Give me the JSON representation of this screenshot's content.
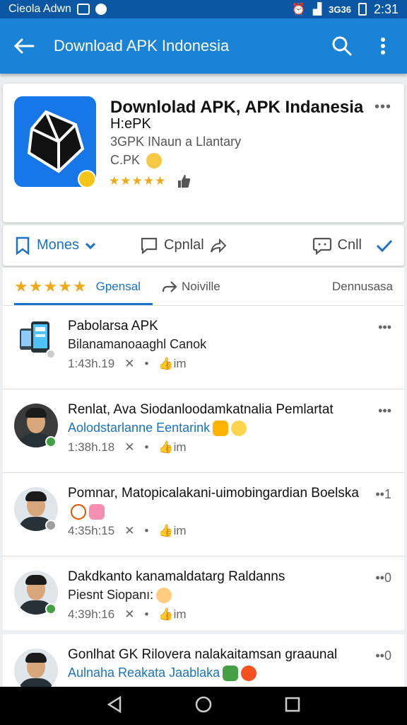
{
  "status_bar": {
    "carrier": "Cieola Adwn",
    "network": "3G36",
    "time": "2:31"
  },
  "app_bar": {
    "title": "Download APK Indonesia"
  },
  "app_card": {
    "title": "Downlolad APK, APK Indanesia",
    "subtitle": "H:ePK",
    "developer": "3GPK INaun a Llantary",
    "category": "C.PK",
    "rating_stars": "★★★★★",
    "more": "•••"
  },
  "actions": {
    "primary": "Mones",
    "middle": "Cpnlal",
    "right": "Cnll"
  },
  "tabs": {
    "stars": "★★★★★",
    "active": "Gpensal",
    "second": "Noiville",
    "third": "Dennusasa"
  },
  "feed": [
    {
      "title": "Pabolarsa APK",
      "subtitle": "Bilanamanoaaghl Canok",
      "time": "1:43h.19",
      "likes": "im",
      "more": "•••"
    },
    {
      "title": "Renlat, Ava Siodanloodamkatnalia Pemlartat",
      "subtitle": "Aolodstarlanne Eentarink",
      "time": "1:38h.18",
      "likes": "im",
      "more": "•••"
    },
    {
      "title": "Pomnar, Matopicalakani-uimobingardian Boelska",
      "subtitle": "",
      "time": "4:35h:15",
      "likes": "im",
      "more": "••1"
    },
    {
      "title": "Dakdkanto kanamaldatarg Raldanns",
      "subtitle": "Piesnt Siopanı:",
      "time": "4:39h:16",
      "likes": "im",
      "more": "••0"
    },
    {
      "title": "Gonlhat GK Rilovera nalakaitamsan graaunal",
      "subtitle": "Aulnaha Reakata Jaablaka",
      "more": "••0"
    }
  ],
  "colors": {
    "appbar": "#1a83d6",
    "statusbar": "#0b57a4",
    "accent": "#1a73c8",
    "star": "#f0a818"
  }
}
